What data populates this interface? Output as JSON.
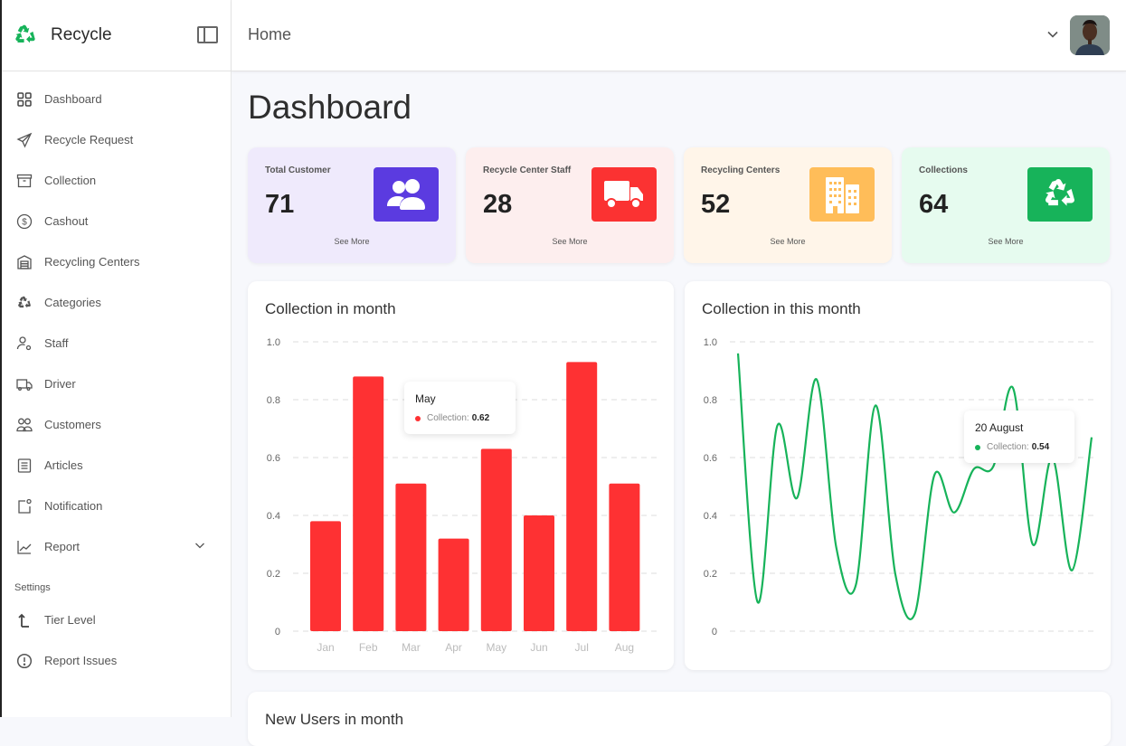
{
  "brand": {
    "name": "Recycle",
    "color": "#17b35a"
  },
  "topbar": {
    "title": "Home"
  },
  "sidebar": {
    "items": [
      {
        "label": "Dashboard",
        "icon": "grid-icon"
      },
      {
        "label": "Recycle Request",
        "icon": "send-icon"
      },
      {
        "label": "Collection",
        "icon": "archive-box-icon"
      },
      {
        "label": "Cashout",
        "icon": "dollar-circle-icon"
      },
      {
        "label": "Recycling Centers",
        "icon": "warehouse-icon"
      },
      {
        "label": "Categories",
        "icon": "recycle-icon"
      },
      {
        "label": "Staff",
        "icon": "user-gear-icon"
      },
      {
        "label": "Driver",
        "icon": "truck-icon"
      },
      {
        "label": "Customers",
        "icon": "users-icon"
      },
      {
        "label": "Articles",
        "icon": "list-icon"
      },
      {
        "label": "Notification",
        "icon": "notification-icon"
      },
      {
        "label": "Report",
        "icon": "chart-line-icon",
        "expandable": true
      }
    ],
    "settings_label": "Settings",
    "settings_items": [
      {
        "label": "Tier Level",
        "icon": "tier-icon"
      },
      {
        "label": "Report Issues",
        "icon": "alert-circle-icon"
      }
    ]
  },
  "page": {
    "title": "Dashboard"
  },
  "stats": [
    {
      "label": "Total Customer",
      "value": "71",
      "link": "See More",
      "bg": "#efeafc",
      "icon_bg": "#5b3be0",
      "icon": "users-icon"
    },
    {
      "label": "Recycle Center Staff",
      "value": "28",
      "link": "See More",
      "bg": "#fdeeee",
      "icon_bg": "#fb3232",
      "icon": "truck-icon"
    },
    {
      "label": "Recycling Centers",
      "value": "52",
      "link": "See More",
      "bg": "#fff5e9",
      "icon_bg": "#ffbd59",
      "icon": "building-icon"
    },
    {
      "label": "Collections",
      "value": "64",
      "link": "See More",
      "bg": "#e6fbef",
      "icon_bg": "#17b35a",
      "icon": "recycle-icon"
    }
  ],
  "chart_data": [
    {
      "type": "bar",
      "title": "Collection in month",
      "categories": [
        "Jan",
        "Feb",
        "Mar",
        "Apr",
        "May",
        "Jun",
        "Jul",
        "Aug"
      ],
      "series": [
        {
          "name": "Collection",
          "values": [
            0.38,
            0.88,
            0.51,
            0.32,
            0.63,
            0.4,
            0.93,
            0.51
          ],
          "color": "#fe3133"
        }
      ],
      "yticks": [
        "0",
        "0.2",
        "0.4",
        "0.6",
        "0.8",
        "1.0"
      ],
      "ylim": [
        0,
        1.0
      ],
      "grid": true,
      "tooltip": {
        "title": "May",
        "series": "Collection:",
        "value": "0.62"
      }
    },
    {
      "type": "line",
      "title": "Collection in this month",
      "series": [
        {
          "name": "Collection",
          "color": "#17b35a",
          "values": [
            0.96,
            0.1,
            0.71,
            0.46,
            0.87,
            0.29,
            0.16,
            0.78,
            0.2,
            0.06,
            0.54,
            0.41,
            0.56,
            0.57,
            0.84,
            0.3,
            0.6,
            0.21,
            0.67
          ]
        }
      ],
      "yticks": [
        "0",
        "0.2",
        "0.4",
        "0.6",
        "0.8",
        "1.0"
      ],
      "ylim": [
        0,
        1.0
      ],
      "grid": true,
      "tooltip": {
        "title": "20 August",
        "series": "Collection:",
        "value": "0.54"
      }
    }
  ],
  "bottom_panel": {
    "title": "New Users in month"
  }
}
